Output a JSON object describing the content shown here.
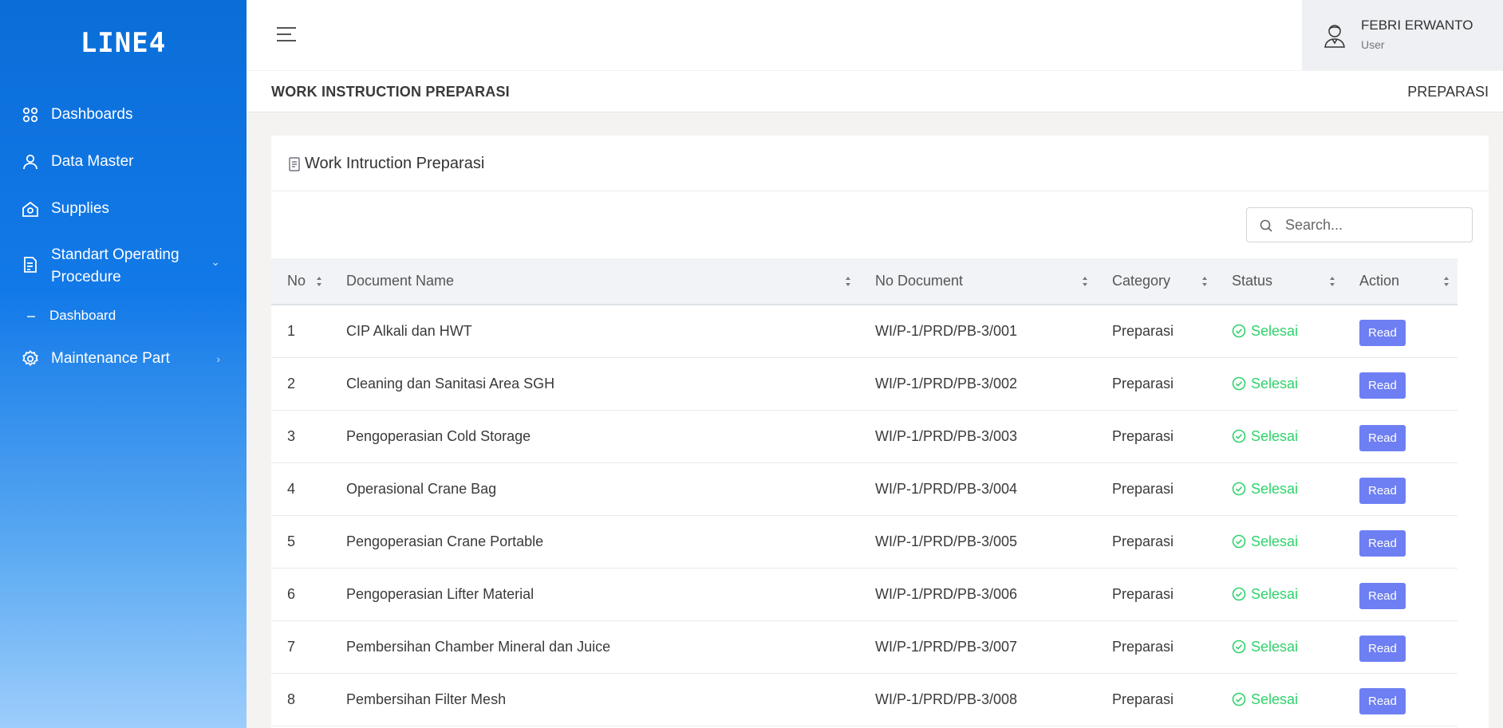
{
  "brand": {
    "logo_text": "LINE4"
  },
  "sidebar": {
    "items": [
      {
        "label": "Dashboards",
        "icon": "grid-icon"
      },
      {
        "label": "Data Master",
        "icon": "user-icon"
      },
      {
        "label": "Supplies",
        "icon": "home-icon"
      },
      {
        "label": "Standart Operating Procedure",
        "icon": "document-icon",
        "sub": [
          {
            "label": "Dashboard"
          }
        ]
      },
      {
        "label": "Maintenance Part",
        "icon": "gear-icon"
      }
    ]
  },
  "topbar": {
    "user_name": "FEBRI ERWANTO",
    "user_role": "User"
  },
  "page": {
    "title": "WORK INSTRUCTION PREPARASI",
    "breadcrumb": "PREPARASI"
  },
  "card": {
    "title": "Work Intruction Preparasi",
    "search_placeholder": "Search..."
  },
  "table": {
    "columns": [
      "No",
      "Document Name",
      "No Document",
      "Category",
      "Status",
      "Action"
    ],
    "rows": [
      {
        "no": "1",
        "name": "CIP Alkali dan HWT",
        "doc": "WI/P-1/PRD/PB-3/001",
        "category": "Preparasi",
        "status": "Selesai",
        "action": "Read"
      },
      {
        "no": "2",
        "name": "Cleaning dan Sanitasi Area SGH",
        "doc": "WI/P-1/PRD/PB-3/002",
        "category": "Preparasi",
        "status": "Selesai",
        "action": "Read"
      },
      {
        "no": "3",
        "name": "Pengoperasian Cold Storage",
        "doc": "WI/P-1/PRD/PB-3/003",
        "category": "Preparasi",
        "status": "Selesai",
        "action": "Read"
      },
      {
        "no": "4",
        "name": "Operasional Crane Bag",
        "doc": "WI/P-1/PRD/PB-3/004",
        "category": "Preparasi",
        "status": "Selesai",
        "action": "Read"
      },
      {
        "no": "5",
        "name": "Pengoperasian Crane Portable",
        "doc": "WI/P-1/PRD/PB-3/005",
        "category": "Preparasi",
        "status": "Selesai",
        "action": "Read"
      },
      {
        "no": "6",
        "name": "Pengoperasian Lifter Material",
        "doc": "WI/P-1/PRD/PB-3/006",
        "category": "Preparasi",
        "status": "Selesai",
        "action": "Read"
      },
      {
        "no": "7",
        "name": "Pembersihan Chamber Mineral dan Juice",
        "doc": "WI/P-1/PRD/PB-3/007",
        "category": "Preparasi",
        "status": "Selesai",
        "action": "Read"
      },
      {
        "no": "8",
        "name": "Pembersihan Filter Mesh",
        "doc": "WI/P-1/PRD/PB-3/008",
        "category": "Preparasi",
        "status": "Selesai",
        "action": "Read"
      }
    ]
  },
  "colors": {
    "sidebar_top": "#0a6ed8",
    "sidebar_bottom": "#9dcdfb",
    "status_ok": "#2fd36b",
    "button": "#6e7ff3"
  }
}
